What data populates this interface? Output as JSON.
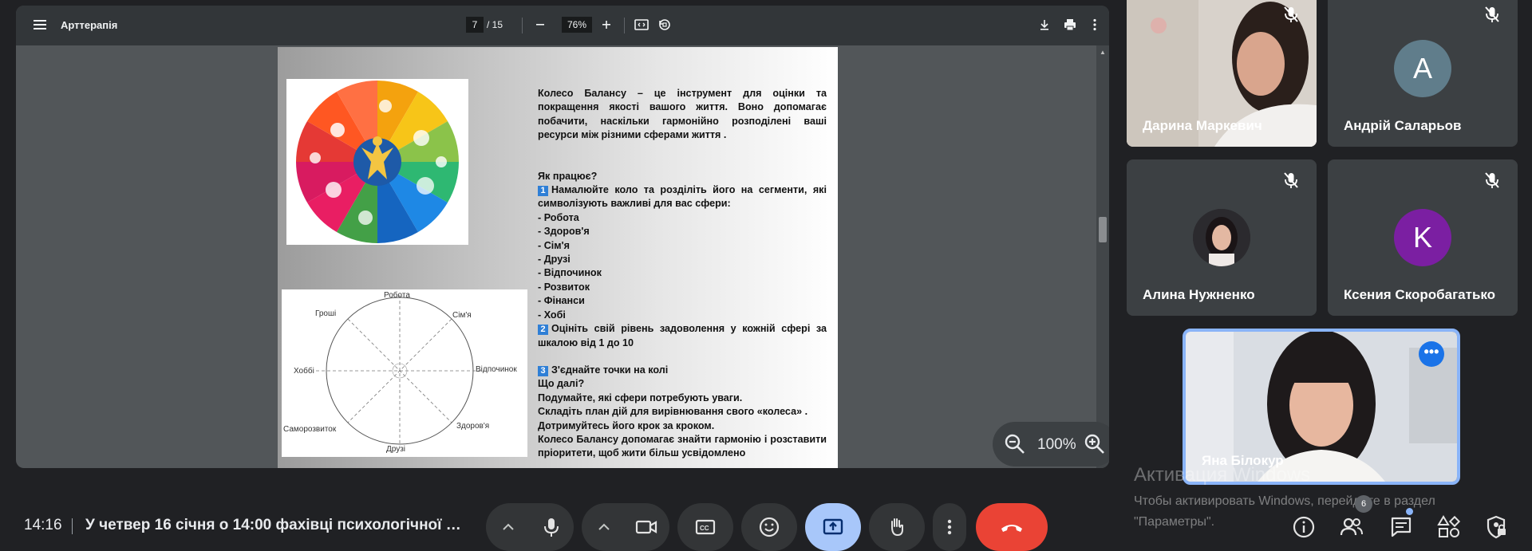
{
  "pdf": {
    "title": "Арттерапія",
    "page_current": "7",
    "page_total": "/ 15",
    "zoom_label": "76%",
    "float_zoom": "100%",
    "text": {
      "intro": "Колесо Балансу – це інструмент для оцінки та покращення якості вашого життя. Воно допомагає побачити, наскільки гармонійно розподілені ваші ресурси між різними сферами життя .",
      "how_title": "Як працює?",
      "step1_num": "1",
      "step1": "Намалюйте коло та розділіть його на сегменти, які символізують важливі для вас сфери:",
      "spheres": [
        "- Робота",
        "- Здоров'я",
        "- Сім'я",
        "- Друзі",
        "- Відпочинок",
        "- Розвиток",
        "- Фінанси",
        "- Хобі"
      ],
      "step2_num": "2",
      "step2": "Оцініть свій рівень задоволення у кожній сфері за шкалою від 1 до 10",
      "step3_num": "3",
      "step3": "З'єднайте точки на колі",
      "next_title": "Що далі?",
      "next1": "Подумайте, які сфери потребують уваги.",
      "next2": "Складіть план дій для вирівнювання свого «колеса» .",
      "next3": "Дотримуйтесь його крок за кроком.",
      "final": "Колесо Балансу допомагає знайти гармонію і розставити пріоритети, щоб жити більш усвідомлено",
      "final_tail": "."
    },
    "diagram_labels": {
      "top": "Робота",
      "top_left": "Гроші",
      "top_right": "Сім'я",
      "left": "Хоббі",
      "right": "Відпочинок",
      "bottom_left": "Саморозвиток",
      "bottom_right": "Здоров'я",
      "bottom": "Друзі"
    }
  },
  "participants": {
    "p1": {
      "name": "Дарина Маркевич"
    },
    "p2": {
      "name": "Андрій Саларьов",
      "initial": "A",
      "color": "#607d8b"
    },
    "p3": {
      "name": "Алина Нужненко"
    },
    "p4": {
      "name": "Ксения Скоробагатько",
      "initial": "K",
      "color": "#7b1fa2"
    },
    "p5": {
      "name": "Яна Білокур"
    }
  },
  "watermark": {
    "line1": "Активация Windows",
    "line2": "Чтобы активировать Windows, перейдите в раздел",
    "line3": "\"Параметры\"."
  },
  "bottom_bar": {
    "time": "14:16",
    "meeting_title": "У четвер 16 січня о 14:00 фахівці психологічної …",
    "people_count": "6"
  },
  "colors": {
    "accent": "#8ab4f8",
    "end_call": "#ea4335",
    "share_active": "#a8c7fa"
  },
  "icons": [
    "menu-icon",
    "zoom-out-icon",
    "zoom-in-icon",
    "fit-page-icon",
    "rotate-icon",
    "download-icon",
    "print-icon",
    "more-vert-icon",
    "mic-off-icon",
    "mic-icon",
    "camera-icon",
    "captions-icon",
    "emoji-icon",
    "present-icon",
    "raise-hand-icon",
    "end-call-icon",
    "info-icon",
    "people-icon",
    "chat-icon",
    "activities-icon",
    "host-controls-icon"
  ]
}
